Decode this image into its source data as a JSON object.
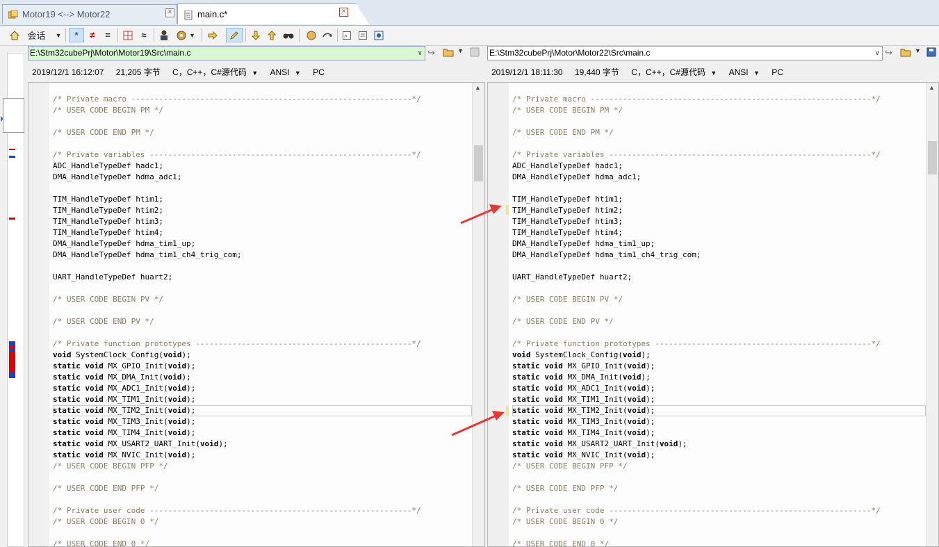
{
  "tabs": [
    {
      "label": "Motor19 <--> Motor22",
      "icon": "compare-folder-icon"
    },
    {
      "label": "main.c*",
      "icon": "text-file-icon"
    }
  ],
  "toolbar": {
    "session_label": "会话",
    "items": [
      "home-icon",
      "session-menu",
      "all-icon",
      "diffs-icon",
      "same-icon",
      "struct-icon",
      "approx-icon",
      "person-icon",
      "rules-icon",
      "next-icon",
      "edit-icon",
      "prev-diff-icon",
      "next-diff-icon",
      "find-icon",
      "swap-icon",
      "sync-icon",
      "expand-icon",
      "list-icon",
      "report-icon"
    ]
  },
  "left": {
    "path": "E:\\Stm32cubePrj\\Motor\\Motor19\\Src\\main.c",
    "date": "2019/12/1 16:12:07",
    "size": "21,205 字节",
    "format": "C，C++，C#源代码",
    "encoding": "ANSI",
    "lineend": "PC"
  },
  "right": {
    "path": "E:\\Stm32cubePrj\\Motor\\Motor22\\Src\\main.c",
    "date": "2019/12/1 18:11:30",
    "size": "19,440 字节",
    "format": "C，C++，C#源代码",
    "encoding": "ANSI",
    "lineend": "PC"
  },
  "code_lines": [
    {
      "text": "/* Private macro -------------------------------------------------------------*/",
      "type": "cmt"
    },
    {
      "text": "/* USER CODE BEGIN PM */",
      "type": "cmt"
    },
    {
      "text": "",
      "type": "blank"
    },
    {
      "text": "/* USER CODE END PM */",
      "type": "cmt"
    },
    {
      "text": "",
      "type": "blank"
    },
    {
      "text": "/* Private variables ---------------------------------------------------------*/",
      "type": "cmt"
    },
    {
      "text": "ADC_HandleTypeDef hadc1;",
      "type": "code"
    },
    {
      "text": "DMA_HandleTypeDef hdma_adc1;",
      "type": "code"
    },
    {
      "text": "",
      "type": "blank"
    },
    {
      "text": "TIM_HandleTypeDef htim1;",
      "type": "code"
    },
    {
      "text": "TIM_HandleTypeDef htim2;",
      "type": "code"
    },
    {
      "text": "TIM_HandleTypeDef htim3;",
      "type": "code"
    },
    {
      "text": "TIM_HandleTypeDef htim4;",
      "type": "code"
    },
    {
      "text": "DMA_HandleTypeDef hdma_tim1_up;",
      "type": "code"
    },
    {
      "text": "DMA_HandleTypeDef hdma_tim1_ch4_trig_com;",
      "type": "code"
    },
    {
      "text": "",
      "type": "blank"
    },
    {
      "text": "UART_HandleTypeDef huart2;",
      "type": "code"
    },
    {
      "text": "",
      "type": "blank"
    },
    {
      "text": "/* USER CODE BEGIN PV */",
      "type": "cmt"
    },
    {
      "text": "",
      "type": "blank"
    },
    {
      "text": "/* USER CODE END PV */",
      "type": "cmt"
    },
    {
      "text": "",
      "type": "blank"
    },
    {
      "text": "/* Private function prototypes -----------------------------------------------*/",
      "type": "cmt"
    },
    {
      "text": "SystemClock_Config",
      "type": "proto",
      "kw": "void ",
      "arg": "void"
    },
    {
      "text": "MX_GPIO_Init",
      "type": "proto",
      "kw": "static void ",
      "arg": "void"
    },
    {
      "text": "MX_DMA_Init",
      "type": "proto",
      "kw": "static void ",
      "arg": "void"
    },
    {
      "text": "MX_ADC1_Init",
      "type": "proto",
      "kw": "static void ",
      "arg": "void"
    },
    {
      "text": "MX_TIM1_Init",
      "type": "proto",
      "kw": "static void ",
      "arg": "void"
    },
    {
      "text": "MX_TIM2_Init",
      "type": "proto",
      "kw": "static void ",
      "arg": "void",
      "current": true
    },
    {
      "text": "MX_TIM3_Init",
      "type": "proto",
      "kw": "static void ",
      "arg": "void"
    },
    {
      "text": "MX_TIM4_Init",
      "type": "proto",
      "kw": "static void ",
      "arg": "void"
    },
    {
      "text": "MX_USART2_UART_Init",
      "type": "proto",
      "kw": "static void ",
      "arg": "void"
    },
    {
      "text": "MX_NVIC_Init",
      "type": "proto",
      "kw": "static void ",
      "arg": "void"
    },
    {
      "text": "/* USER CODE BEGIN PFP */",
      "type": "cmt"
    },
    {
      "text": "",
      "type": "blank"
    },
    {
      "text": "/* USER CODE END PFP */",
      "type": "cmt"
    },
    {
      "text": "",
      "type": "blank"
    },
    {
      "text": "/* Private user code ---------------------------------------------------------*/",
      "type": "cmt"
    },
    {
      "text": "/* USER CODE BEGIN 0 */",
      "type": "cmt"
    },
    {
      "text": "",
      "type": "blank"
    },
    {
      "text": "/* USER CODE END 0 */",
      "type": "cmt"
    }
  ],
  "colors": {
    "comment": "#8b7d62",
    "diff_red": "#e00000",
    "diff_blue": "#1c3fd0",
    "arrow": "#e53935",
    "path_left_bg": "#d9f7d4",
    "path_right_bg": "#ffffff"
  }
}
